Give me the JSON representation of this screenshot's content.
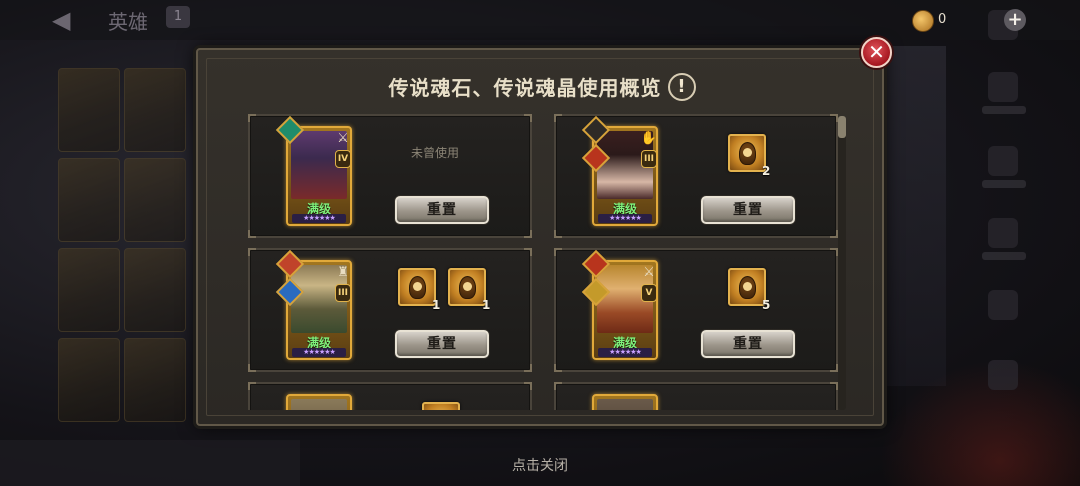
{
  "topbar": {
    "title": "英雄",
    "title_badge": "1",
    "currency_value": "0"
  },
  "modal": {
    "title": "传说魂石、传说魂晶使用概览",
    "info_glyph": "!",
    "close_glyph": "✕"
  },
  "heroes": [
    {
      "level_label": "满级",
      "tier": "IV",
      "class_glyph": "⚔",
      "status_text": "未曾使用",
      "stones": [],
      "reset_label": "重置",
      "colors": {
        "badge": "#1f8c6b",
        "portrait_top": "#5e3a6e",
        "portrait_bottom": "#7a2a2a"
      }
    },
    {
      "level_label": "满级",
      "tier": "III",
      "class_glyph": "✋",
      "status_text": "",
      "stones": [
        {
          "count": "2"
        }
      ],
      "reset_label": "重置",
      "colors": {
        "badge": "#b8341d",
        "portrait_top": "#3a1f1f",
        "portrait_bottom": "#d7b7a6"
      }
    },
    {
      "level_label": "满级",
      "tier": "III",
      "class_glyph": "♜",
      "status_text": "",
      "stones": [
        {
          "count": "1"
        },
        {
          "count": "1"
        }
      ],
      "reset_label": "重置",
      "colors": {
        "badge": "#c0432a",
        "badge2": "#2a6bc0",
        "portrait_top": "#8c7a55",
        "portrait_bottom": "#3a4a2e"
      }
    },
    {
      "level_label": "满级",
      "tier": "V",
      "class_glyph": "⚔",
      "status_text": "",
      "stones": [
        {
          "count": "5"
        }
      ],
      "reset_label": "重置",
      "colors": {
        "badge": "#b8341d",
        "portrait_top": "#b8862e",
        "portrait_bottom": "#6e2a16"
      }
    }
  ],
  "footer": {
    "tap_to_close": "点击关闭"
  }
}
